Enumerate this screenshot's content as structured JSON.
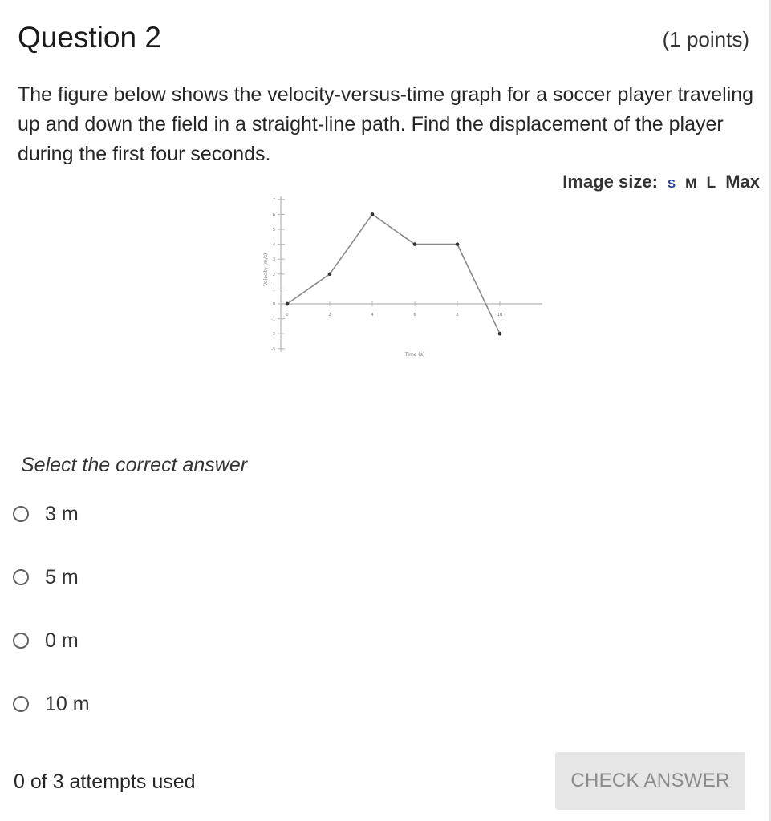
{
  "question": {
    "title": "Question 2",
    "points": "(1 points)",
    "text": "The figure below shows the velocity-versus-time graph for a soccer player traveling up and down the field in a straight-line path. Find the displacement of the player during the first four seconds."
  },
  "image_size": {
    "label": "Image size:",
    "options": [
      "S",
      "M",
      "L",
      "Max"
    ],
    "selected": "S"
  },
  "chart_data": {
    "type": "line",
    "xlabel": "Time (s)",
    "ylabel": "Velocity (m/s)",
    "xlim": [
      0,
      12
    ],
    "ylim": [
      -3,
      7
    ],
    "x_ticks": [
      "0",
      "2",
      "4",
      "6",
      "8",
      "10"
    ],
    "y_ticks": [
      "7",
      "6",
      "5",
      "4",
      "3",
      "2",
      "1",
      "0",
      "-1",
      "-2",
      "-3"
    ],
    "x": [
      0,
      2,
      4,
      6,
      8,
      10
    ],
    "y": [
      0,
      2,
      6,
      4,
      4,
      -2
    ],
    "grid": false,
    "colors": {
      "line": "#8a8a8a",
      "marker": "#333333",
      "axis": "#b5b5b5"
    }
  },
  "answers": {
    "prompt": "Select the correct answer",
    "options": [
      "3 m",
      "5 m",
      "0 m",
      "10 m"
    ]
  },
  "footer": {
    "attempts": "0 of 3 attempts used",
    "check_label": "CHECK ANSWER"
  }
}
